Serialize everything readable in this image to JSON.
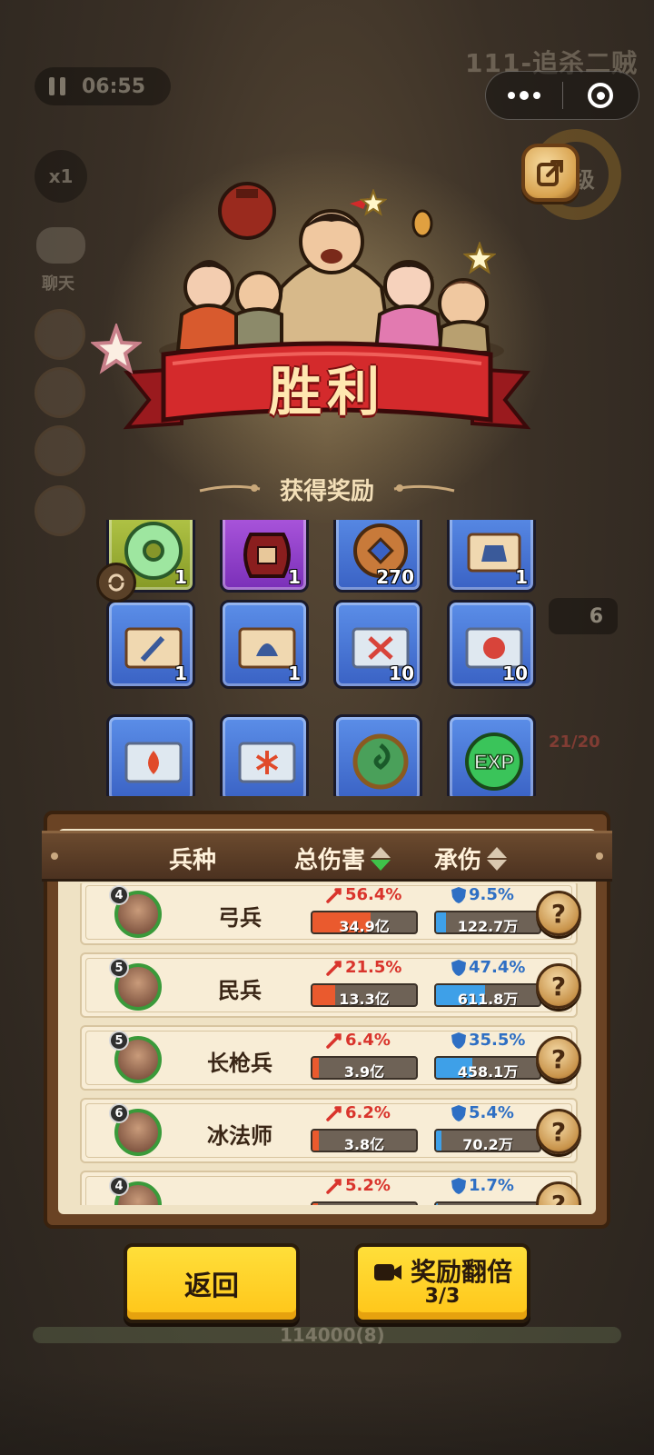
{
  "background": {
    "level_title": "111-追杀二贼",
    "timer": "06:55",
    "speed": "x1",
    "chat_label": "聊天",
    "level_badge_partial": "6级",
    "side_count": "6",
    "hp_text": "21/20",
    "score_text": "114000(8)"
  },
  "header": {
    "victory": "胜利",
    "reward_title": "获得奖励"
  },
  "rewards": [
    {
      "icon": "jade-disc-icon",
      "color": "green",
      "qty": "1"
    },
    {
      "icon": "wine-jar-icon",
      "color": "purple",
      "qty": "1"
    },
    {
      "icon": "copper-coin-icon",
      "color": "blue",
      "qty": "270"
    },
    {
      "icon": "armor-scroll-icon",
      "color": "blue",
      "qty": "1"
    },
    {
      "icon": "sword-scroll-icon",
      "color": "blue",
      "qty": "1"
    },
    {
      "icon": "helmet-scroll-icon",
      "color": "blue",
      "qty": "1"
    },
    {
      "icon": "crossed-weapons-scroll-icon",
      "color": "blue",
      "qty": "10"
    },
    {
      "icon": "shield-scroll-icon",
      "color": "blue",
      "qty": "10"
    },
    {
      "icon": "fire-scroll-icon",
      "color": "blue",
      "qty": ""
    },
    {
      "icon": "ice-scroll-icon",
      "color": "blue",
      "qty": ""
    },
    {
      "icon": "jade-swirl-icon",
      "color": "blue",
      "qty": ""
    },
    {
      "icon": "exp-orb-icon",
      "color": "blue",
      "qty": ""
    }
  ],
  "stats": {
    "col_unit": "兵种",
    "col_damage": "总伤害",
    "col_taken": "承伤",
    "rows": [
      {
        "level": "4",
        "name": "弓兵",
        "dmg_pct": "56.4%",
        "dmg_val": "34.9亿",
        "dmg_fill": 0.564,
        "tank_pct": "9.5%",
        "tank_val": "122.7万",
        "tank_fill": 0.095
      },
      {
        "level": "5",
        "name": "民兵",
        "dmg_pct": "21.5%",
        "dmg_val": "13.3亿",
        "dmg_fill": 0.215,
        "tank_pct": "47.4%",
        "tank_val": "611.8万",
        "tank_fill": 0.474
      },
      {
        "level": "5",
        "name": "长枪兵",
        "dmg_pct": "6.4%",
        "dmg_val": "3.9亿",
        "dmg_fill": 0.064,
        "tank_pct": "35.5%",
        "tank_val": "458.1万",
        "tank_fill": 0.355
      },
      {
        "level": "6",
        "name": "冰法师",
        "dmg_pct": "6.2%",
        "dmg_val": "3.8亿",
        "dmg_fill": 0.062,
        "tank_pct": "5.4%",
        "tank_val": "70.2万",
        "tank_fill": 0.054
      },
      {
        "level": "4",
        "name": "",
        "dmg_pct": "5.2%",
        "dmg_val": "",
        "dmg_fill": 0.052,
        "tank_pct": "1.7%",
        "tank_val": "",
        "tank_fill": 0.017
      }
    ],
    "help_label": "?"
  },
  "buttons": {
    "back": "返回",
    "double_reward": "奖励翻倍",
    "double_count": "3/3"
  },
  "colors": {
    "button_yellow": "#ffc518",
    "ribbon_red": "#c8262a",
    "damage_red": "#d9342c",
    "tank_blue": "#2e6fc4",
    "panel_brown": "#6a4324"
  }
}
